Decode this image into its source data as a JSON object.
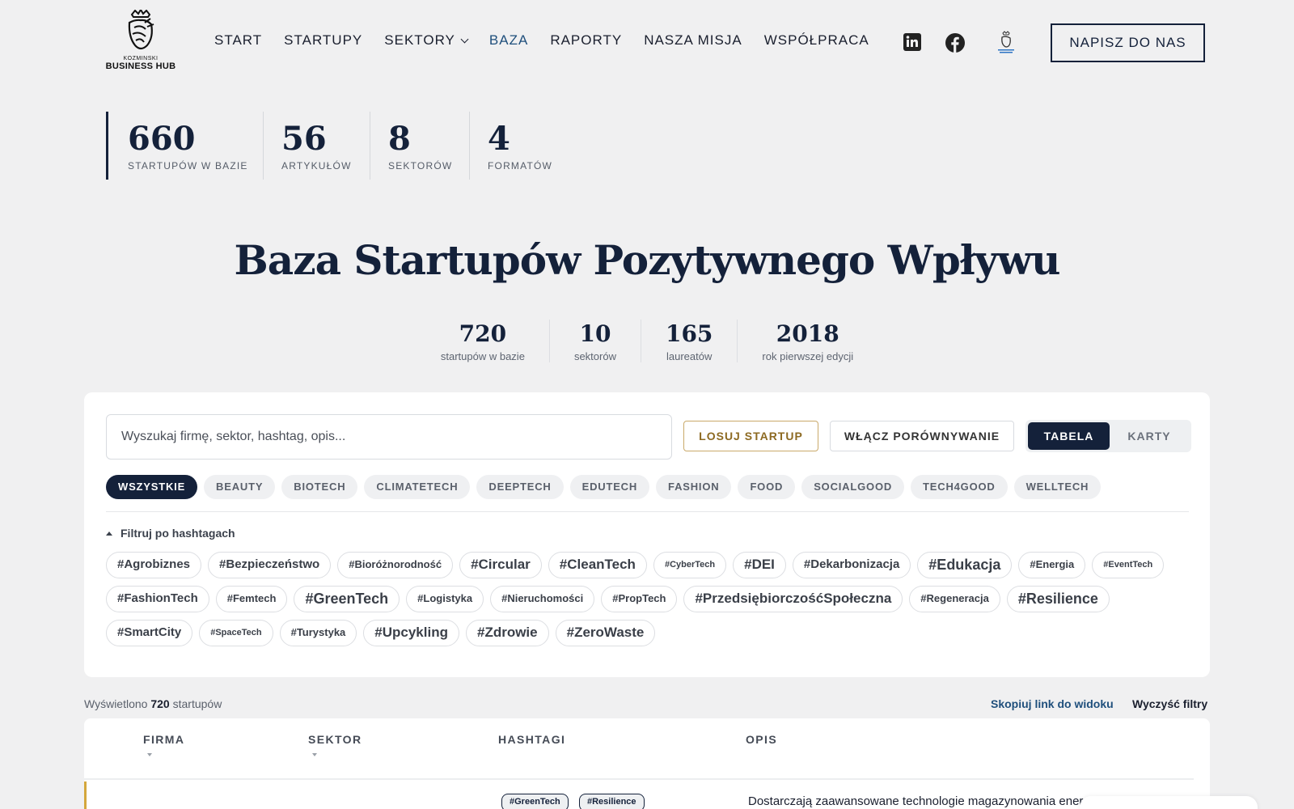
{
  "header": {
    "logo_small": "KOZMINSKI",
    "logo_big": "BUSINESS HUB",
    "nav": [
      {
        "label": "START",
        "active": false
      },
      {
        "label": "STARTUPY",
        "active": false
      },
      {
        "label": "SEKTORY",
        "active": false,
        "dropdown": true
      },
      {
        "label": "BAZA",
        "active": true
      },
      {
        "label": "RAPORTY",
        "active": false
      },
      {
        "label": "NASZA MISJA",
        "active": false
      },
      {
        "label": "WSPÓŁPRACA",
        "active": false
      }
    ],
    "social_icons": [
      "linkedin-icon",
      "facebook-icon",
      "kozminski-hub-icon"
    ],
    "contact_label": "NAPISZ DO NAS"
  },
  "top_stats": [
    {
      "value": "660",
      "label": "STARTUPÓW W BAZIE"
    },
    {
      "value": "56",
      "label": "ARTYKUŁÓW"
    },
    {
      "value": "8",
      "label": "SEKTORÓW"
    },
    {
      "value": "4",
      "label": "FORMATÓW"
    }
  ],
  "title": "Baza Startupów Pozytywnego Wpływu",
  "mid_stats": [
    {
      "value": "720",
      "label": "startupów w bazie"
    },
    {
      "value": "10",
      "label": "sektorów"
    },
    {
      "value": "165",
      "label": "laureatów"
    },
    {
      "value": "2018",
      "label": "rok pierwszej edycji"
    }
  ],
  "panel": {
    "search_placeholder": "Wyszukaj firmę, sektor, hashtag, opis...",
    "random_label": "LOSUJ STARTUP",
    "compare_label": "WŁĄCZ PORÓWNYWANIE",
    "view_table": "TABELA",
    "view_cards": "KARTY",
    "sectors": [
      "WSZYSTKIE",
      "BEAUTY",
      "BIOTECH",
      "CLIMATETECH",
      "DEEPTECH",
      "EDUTECH",
      "FASHION",
      "FOOD",
      "SOCIALGOOD",
      "TECH4GOOD",
      "WELLTECH"
    ],
    "active_sector": "WSZYSTKIE",
    "filter_label": "Filtruj po hashtagach",
    "hashtags": [
      {
        "label": "#Agrobiznes",
        "size": 3
      },
      {
        "label": "#Bezpieczeństwo",
        "size": 3
      },
      {
        "label": "#Bioróżnorodność",
        "size": 2
      },
      {
        "label": "#Circular",
        "size": 4
      },
      {
        "label": "#CleanTech",
        "size": 4
      },
      {
        "label": "#CyberTech",
        "size": 1
      },
      {
        "label": "#DEI",
        "size": 4
      },
      {
        "label": "#Dekarbonizacja",
        "size": 3
      },
      {
        "label": "#Edukacja",
        "size": 5
      },
      {
        "label": "#Energia",
        "size": 2
      },
      {
        "label": "#EventTech",
        "size": 1
      },
      {
        "label": "#FashionTech",
        "size": 3
      },
      {
        "label": "#Femtech",
        "size": 2
      },
      {
        "label": "#GreenTech",
        "size": 5
      },
      {
        "label": "#Logistyka",
        "size": 2
      },
      {
        "label": "#Nieruchomości",
        "size": 2
      },
      {
        "label": "#PropTech",
        "size": 2
      },
      {
        "label": "#PrzedsiębiorczośćSpołeczna",
        "size": 4
      },
      {
        "label": "#Regeneracja",
        "size": 2
      },
      {
        "label": "#Resilience",
        "size": 5
      },
      {
        "label": "#SmartCity",
        "size": 3
      },
      {
        "label": "#SpaceTech",
        "size": 1
      },
      {
        "label": "#Turystyka",
        "size": 2
      },
      {
        "label": "#Upcykling",
        "size": 4
      },
      {
        "label": "#Zdrowie",
        "size": 4
      },
      {
        "label": "#ZeroWaste",
        "size": 4
      }
    ]
  },
  "results": {
    "prefix": "Wyświetlono",
    "count": "720",
    "suffix": "startupów",
    "copy_link": "Skopiuj link do widoku",
    "clear": "Wyczyść filtry"
  },
  "table": {
    "headers": [
      "FIRMA",
      "SEKTOR",
      "HASHTAGI",
      "OPIS"
    ],
    "first_row": {
      "hashtags": [
        "#GreenTech",
        "#Resilience"
      ],
      "description": "Dostarczają zaawansowane technologie magazynowania ener"
    }
  },
  "colors": {
    "navy": "#14213a",
    "accent_blue": "#1f4f7c",
    "gold": "#c9a96a",
    "background": "#f0f0f1"
  }
}
